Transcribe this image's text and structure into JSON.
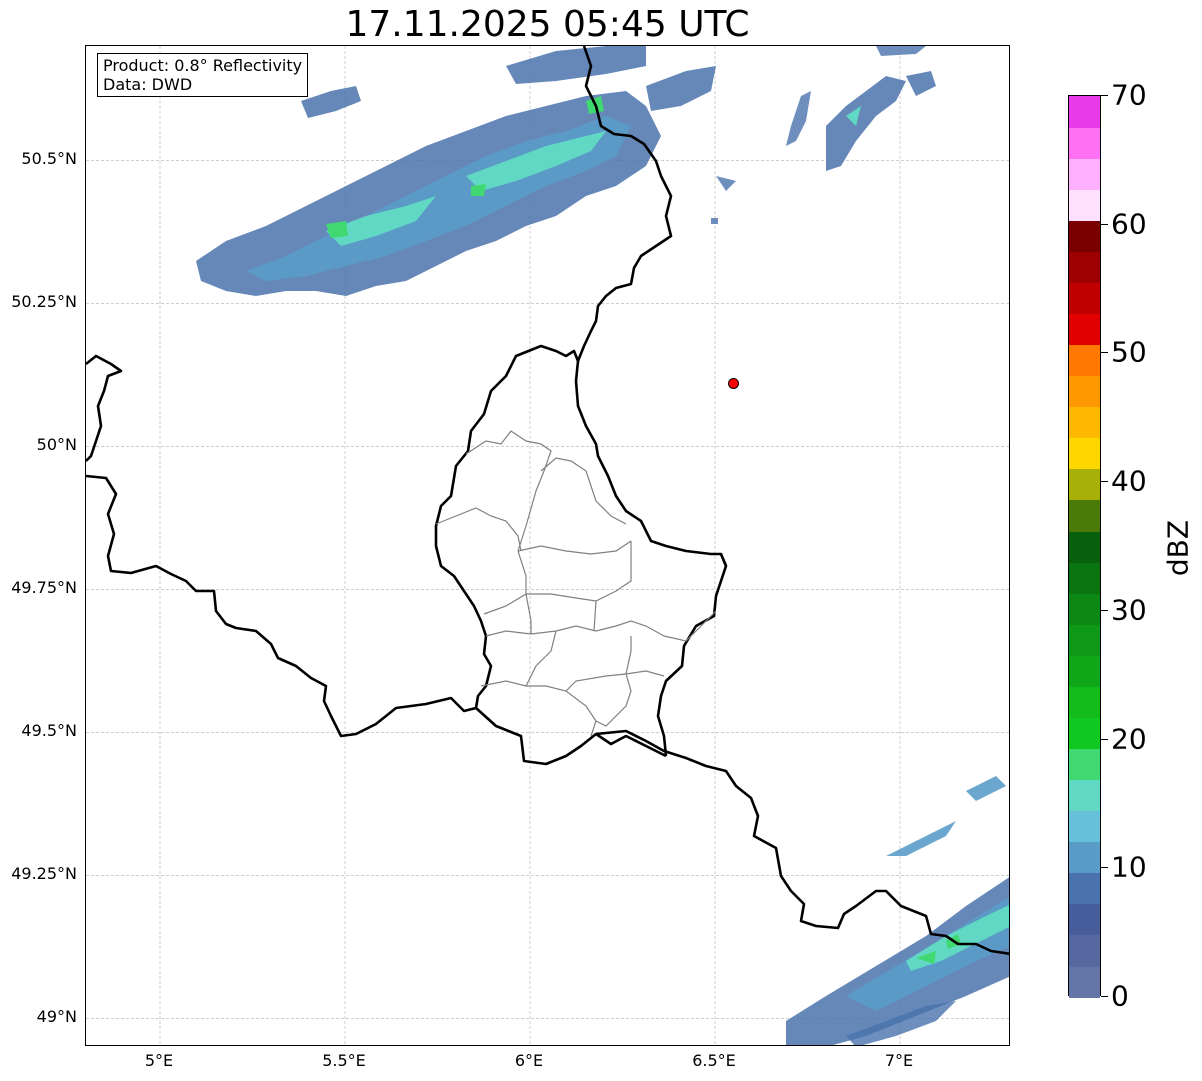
{
  "title": "17.11.2025 05:45 UTC",
  "info": {
    "product": "Product: 0.8° Reflectivity",
    "data": "Data: DWD"
  },
  "map": {
    "extent": {
      "lon_min": 4.8,
      "lon_max": 7.3,
      "lat_min": 48.95,
      "lat_max": 50.7
    },
    "lat_ticks": [
      {
        "value": 50.5,
        "label": "50.5°N"
      },
      {
        "value": 50.25,
        "label": "50.25°N"
      },
      {
        "value": 50.0,
        "label": "50°N"
      },
      {
        "value": 49.75,
        "label": "49.75°N"
      },
      {
        "value": 49.5,
        "label": "49.5°N"
      },
      {
        "value": 49.25,
        "label": "49.25°N"
      },
      {
        "value": 49.0,
        "label": "49°N"
      }
    ],
    "lon_ticks": [
      {
        "value": 5.0,
        "label": "5°E"
      },
      {
        "value": 5.5,
        "label": "5.5°E"
      },
      {
        "value": 6.0,
        "label": "6°E"
      },
      {
        "value": 6.5,
        "label": "6.5°E"
      },
      {
        "value": 7.0,
        "label": "7°E"
      }
    ],
    "gridlines": true,
    "radar_site": {
      "lon": 6.55,
      "lat": 50.11,
      "color": "#ff0000"
    },
    "colors": {
      "border": "#000000",
      "district": "#808080",
      "grid": "#b0b0b0"
    }
  },
  "colorbar": {
    "unit": "dBZ",
    "min": 0,
    "max": 70,
    "step": 2.5,
    "tick_labels": [
      "0",
      "10",
      "20",
      "30",
      "40",
      "50",
      "60",
      "70"
    ],
    "colors": [
      "#6475a8",
      "#55689f",
      "#465c9b",
      "#4a73ad",
      "#5a9cc8",
      "#66c0da",
      "#60d8c4",
      "#40d870",
      "#10c820",
      "#12bc1a",
      "#10a818",
      "#0f9818",
      "#0d8814",
      "#0a7510",
      "#07600c",
      "#4a7a08",
      "#a8b008",
      "#ffd700",
      "#ffb800",
      "#ff9800",
      "#ff7800",
      "#e00000",
      "#c00000",
      "#9c0000",
      "#7a0000",
      "#ffe0ff",
      "#ffb0ff",
      "#ff70f5",
      "#e83ae8"
    ]
  }
}
